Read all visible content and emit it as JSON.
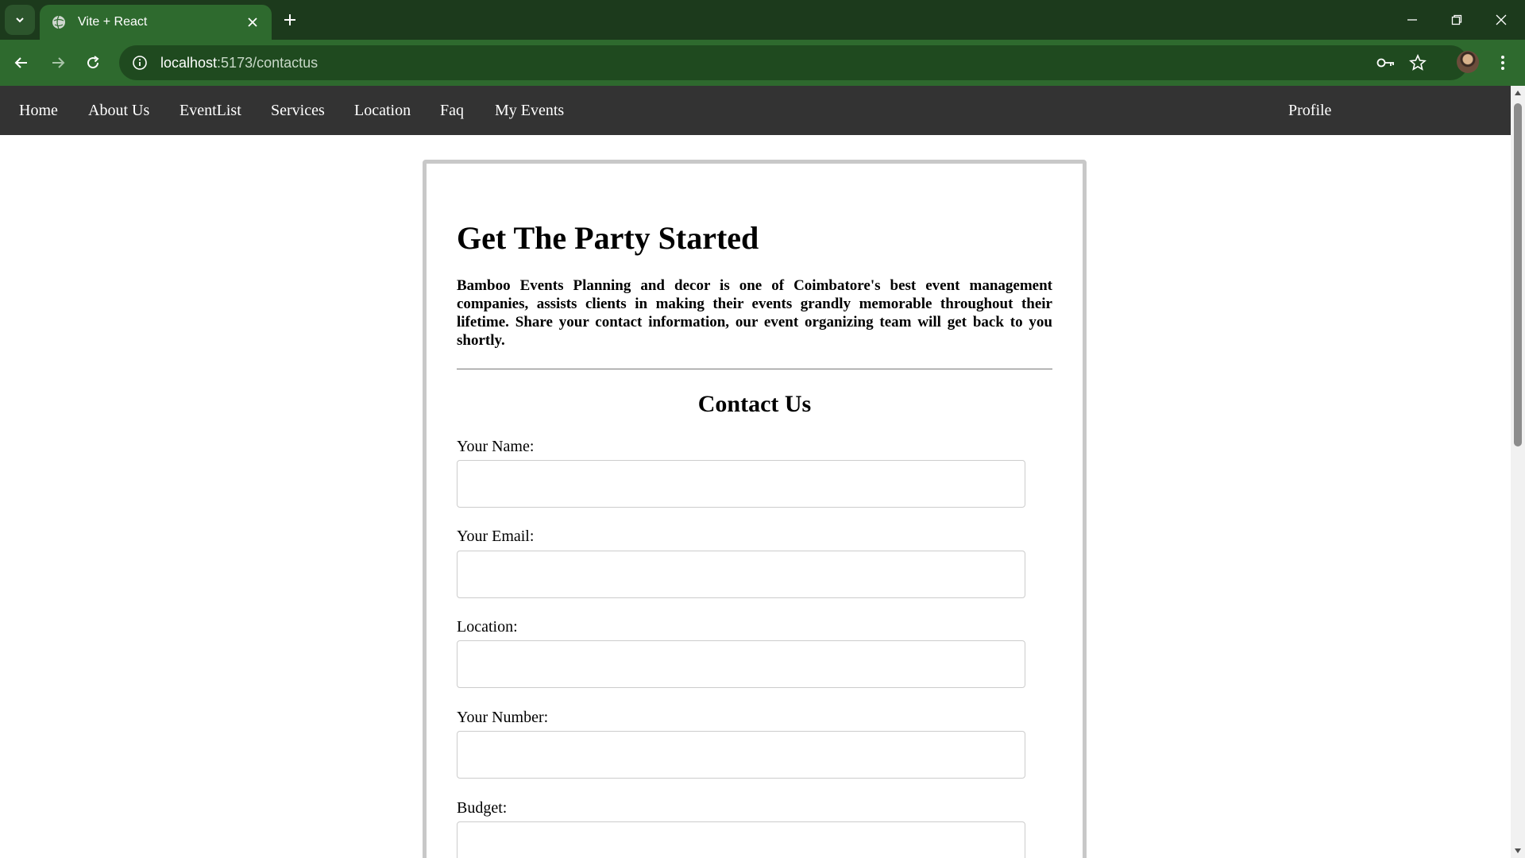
{
  "browser": {
    "tab_title": "Vite + React",
    "url_host": "localhost",
    "url_path": ":5173/contactus",
    "icons": [
      "tab-search-icon",
      "globe-icon",
      "close-icon",
      "plus-icon",
      "minimize-icon",
      "restore-icon",
      "close-window-icon",
      "back-arrow-icon",
      "forward-arrow-icon",
      "reload-icon",
      "site-info-icon",
      "password-key-icon",
      "bookmark-star-icon",
      "kebab-menu-icon"
    ]
  },
  "nav": {
    "links": [
      "Home",
      "About Us",
      "EventList",
      "Services",
      "Location",
      "Faq",
      "My Events"
    ],
    "profile": "Profile"
  },
  "content": {
    "headline": "Get The Party Started",
    "intro": "Bamboo Events Planning and decor is one of Coimbatore's best event management companies, assists clients in making their events grandly memorable throughout their lifetime. Share your contact information, our event organizing team will get back to you shortly.",
    "contact_title": "Contact Us",
    "fields": [
      {
        "label": "Your Name:",
        "value": ""
      },
      {
        "label": "Your Email:",
        "value": ""
      },
      {
        "label": "Location:",
        "value": ""
      },
      {
        "label": "Your Number:",
        "value": ""
      },
      {
        "label": "Budget:",
        "value": ""
      }
    ]
  },
  "colors": {
    "tabbar": "#1c3a1c",
    "toolbar": "#2e6a2e",
    "sitenav": "#333333",
    "card_border": "#c8c8c8"
  }
}
